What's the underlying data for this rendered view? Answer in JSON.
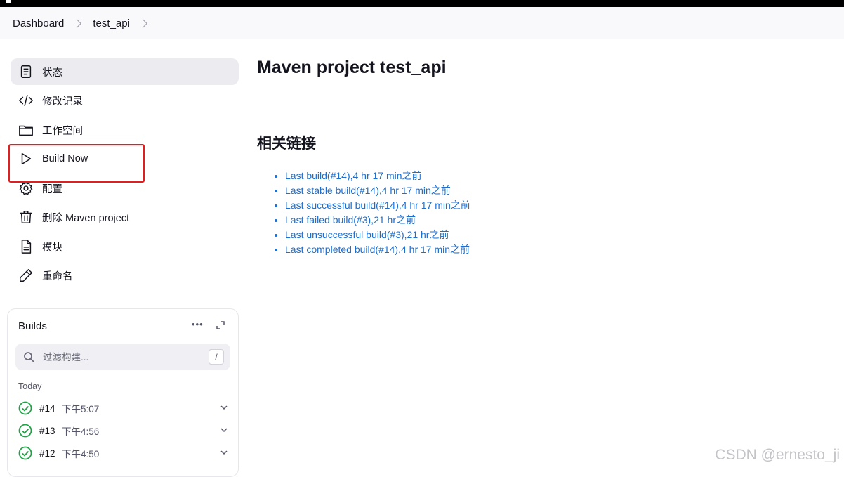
{
  "breadcrumb": {
    "items": [
      "Dashboard",
      "test_api"
    ]
  },
  "sidebar": {
    "items": [
      {
        "label": "状态",
        "icon": "document-icon"
      },
      {
        "label": "修改记录",
        "icon": "code-icon"
      },
      {
        "label": "工作空间",
        "icon": "folder-icon"
      },
      {
        "label": "Build Now",
        "icon": "play-icon"
      },
      {
        "label": "配置",
        "icon": "gear-icon"
      },
      {
        "label": "删除 Maven project",
        "icon": "trash-icon"
      },
      {
        "label": "模块",
        "icon": "file-icon"
      },
      {
        "label": "重命名",
        "icon": "pencil-icon"
      }
    ]
  },
  "builds": {
    "title": "Builds",
    "more": "•••",
    "filter_placeholder": "过滤构建...",
    "filter_shortcut": "/",
    "group_label": "Today",
    "rows": [
      {
        "number": "#14",
        "time": "下午5:07"
      },
      {
        "number": "#13",
        "time": "下午4:56"
      },
      {
        "number": "#12",
        "time": "下午4:50"
      }
    ]
  },
  "main": {
    "title": "Maven project test_api",
    "section_title": "相关链接",
    "links": [
      "Last build(#14),4 hr 17 min之前",
      "Last stable build(#14),4 hr 17 min之前",
      "Last successful build(#14),4 hr 17 min之前",
      "Last failed build(#3),21 hr之前",
      "Last unsuccessful build(#3),21 hr之前",
      "Last completed build(#14),4 hr 17 min之前"
    ]
  },
  "watermark": "CSDN @ernesto_ji",
  "colors": {
    "link": "#1a6fd0",
    "success": "#1ea446",
    "highlight": "#e02020",
    "active_bg": "#ebebf0"
  }
}
